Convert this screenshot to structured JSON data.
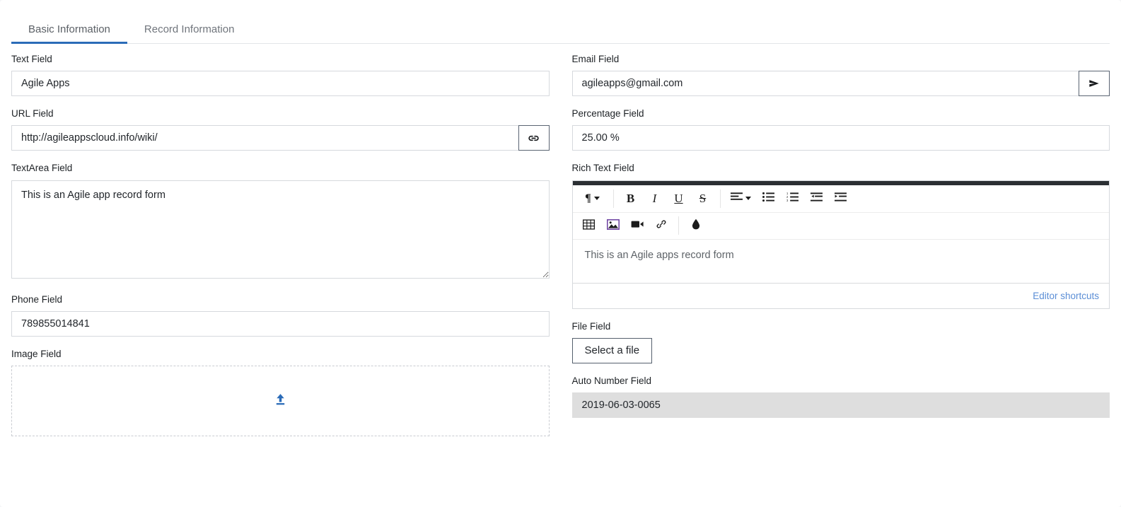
{
  "tabs": [
    {
      "label": "Basic Information",
      "active": true
    },
    {
      "label": "Record Information",
      "active": false
    }
  ],
  "colors": {
    "accent": "#2b6cb8",
    "link": "#5b8ed6",
    "editor_topbar": "#2b2f33",
    "readonly_bg": "#dedede",
    "border": "#d6d9dd"
  },
  "left_column": {
    "text_field": {
      "label": "Text Field",
      "value": "Agile Apps",
      "placeholder": ""
    },
    "url_field": {
      "label": "URL Field",
      "value": "http://agileappscloud.info/wiki/",
      "placeholder": "",
      "button_icon": "link-icon"
    },
    "textarea_field": {
      "label": "TextArea Field",
      "value": "This is an Agile app record form",
      "placeholder": ""
    },
    "phone_field": {
      "label": "Phone Field",
      "value": "789855014841",
      "placeholder": ""
    },
    "image_field": {
      "label": "Image Field",
      "upload_icon": "upload-icon"
    }
  },
  "right_column": {
    "email_field": {
      "label": "Email Field",
      "value": "agileapps@gmail.com",
      "placeholder": "",
      "button_icon": "send-icon"
    },
    "percentage_field": {
      "label": "Percentage Field",
      "value": "25.00 %",
      "placeholder": ""
    },
    "rich_text_field": {
      "label": "Rich Text Field",
      "content": "This is an Agile apps record form",
      "shortcuts_link": "Editor shortcuts",
      "toolbar_row1": [
        {
          "icon": "paragraph-format-icon",
          "glyph": "¶",
          "caret": true
        },
        {
          "sep": true
        },
        {
          "icon": "bold-icon",
          "glyph": "B"
        },
        {
          "icon": "italic-icon",
          "glyph": "I"
        },
        {
          "icon": "underline-icon",
          "glyph": "U"
        },
        {
          "icon": "strikethrough-icon",
          "glyph": "S"
        },
        {
          "sep": true
        },
        {
          "icon": "align-left-icon",
          "glyph": "align",
          "caret": true
        },
        {
          "icon": "unordered-list-icon",
          "glyph": "ul"
        },
        {
          "icon": "ordered-list-icon",
          "glyph": "ol"
        },
        {
          "icon": "outdent-icon",
          "glyph": "outdent"
        },
        {
          "icon": "indent-icon",
          "glyph": "indent"
        }
      ],
      "toolbar_row2": [
        {
          "icon": "table-icon",
          "glyph": "table"
        },
        {
          "icon": "insert-image-icon",
          "glyph": "image"
        },
        {
          "icon": "insert-video-icon",
          "glyph": "video"
        },
        {
          "icon": "insert-link-icon",
          "glyph": "link"
        },
        {
          "sep": true
        },
        {
          "icon": "text-color-icon",
          "glyph": "droplet"
        }
      ]
    },
    "file_field": {
      "label": "File Field",
      "button_label": "Select a file"
    },
    "auto_number_field": {
      "label": "Auto Number Field",
      "value": "2019-06-03-0065",
      "readonly": true
    }
  }
}
